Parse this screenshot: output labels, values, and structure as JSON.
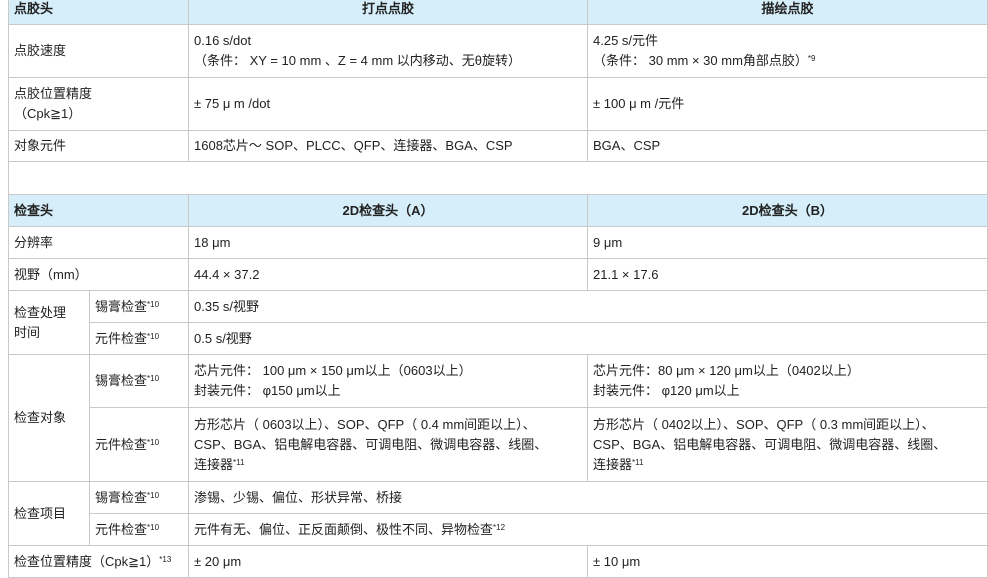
{
  "dispense": {
    "header": {
      "label": "点胶头",
      "col_a": "打点点胶",
      "col_b": "描绘点胶"
    },
    "rows": [
      {
        "label": "点胶速度",
        "a": [
          "0.16 s/dot",
          "（条件： XY = 10 mm 、Z = 4 mm 以内移动、无θ旋转）"
        ],
        "b": [
          "4.25 s/元件",
          "（条件： 30 mm × 30 mm角部点胶）"
        ],
        "b_note": "*9"
      },
      {
        "label": [
          "点胶位置精度",
          "（Cpk≧1）"
        ],
        "a": "± 75 μ m /dot",
        "b": "± 100 μ m /元件"
      },
      {
        "label": "对象元件",
        "a": "1608芯片～ SOP、PLCC、QFP、连接器、BGA、CSP",
        "b": "BGA、CSP"
      }
    ]
  },
  "inspect": {
    "header": {
      "label": "检查头",
      "col_a": "2D检查头（A）",
      "col_b": "2D检查头（B）"
    },
    "resolution": {
      "label": "分辨率",
      "a": "18 μm",
      "b": "9 μm"
    },
    "fov": {
      "label": "视野（mm）",
      "a": "44.4 × 37.2",
      "b": "21.1 × 17.6"
    },
    "time": {
      "label": [
        "检查处理",
        "时间"
      ],
      "solder": {
        "label": "锡膏检查",
        "note": "*10",
        "value": "0.35 s/视野"
      },
      "component": {
        "label": "元件检查",
        "note": "*10",
        "value": "0.5 s/视野"
      }
    },
    "target": {
      "label": "检查对象",
      "solder": {
        "label": "锡膏检查",
        "note": "*10",
        "a": [
          "芯片元件： 100 μm × 150 μm以上（0603以上）",
          "封装元件： φ150 μm以上"
        ],
        "b": [
          "芯片元件：80 μm × 120 μm以上（0402以上）",
          "封装元件： φ120 μm以上"
        ]
      },
      "component": {
        "label": "元件检查",
        "note": "*10",
        "a": [
          "方形芯片（ 0603以上）、SOP、QFP（ 0.4 mm间距以上）、",
          "CSP、BGA、铝电解电容器、可调电阻、微调电容器、线圈、",
          "连接器"
        ],
        "a_note": "*11",
        "b": [
          "方形芯片（ 0402以上）、SOP、QFP（ 0.3 mm间距以上）、",
          "CSP、BGA、铝电解电容器、可调电阻、微调电容器、线圈、",
          "连接器"
        ],
        "b_note": "*11"
      }
    },
    "items": {
      "label": "检查项目",
      "solder": {
        "label": "锡膏检查",
        "note": "*10",
        "value": "渗锡、少锡、偏位、形状异常、桥接"
      },
      "component": {
        "label": "元件检查",
        "note": "*10",
        "value": "元件有无、偏位、正反面颠倒、极性不同、异物检查",
        "value_note": "*12"
      }
    },
    "accuracy": {
      "label": "检查位置精度（Cpk≧1）",
      "note": "*13",
      "a": "± 20 μm",
      "b": "± 10 μm"
    }
  }
}
